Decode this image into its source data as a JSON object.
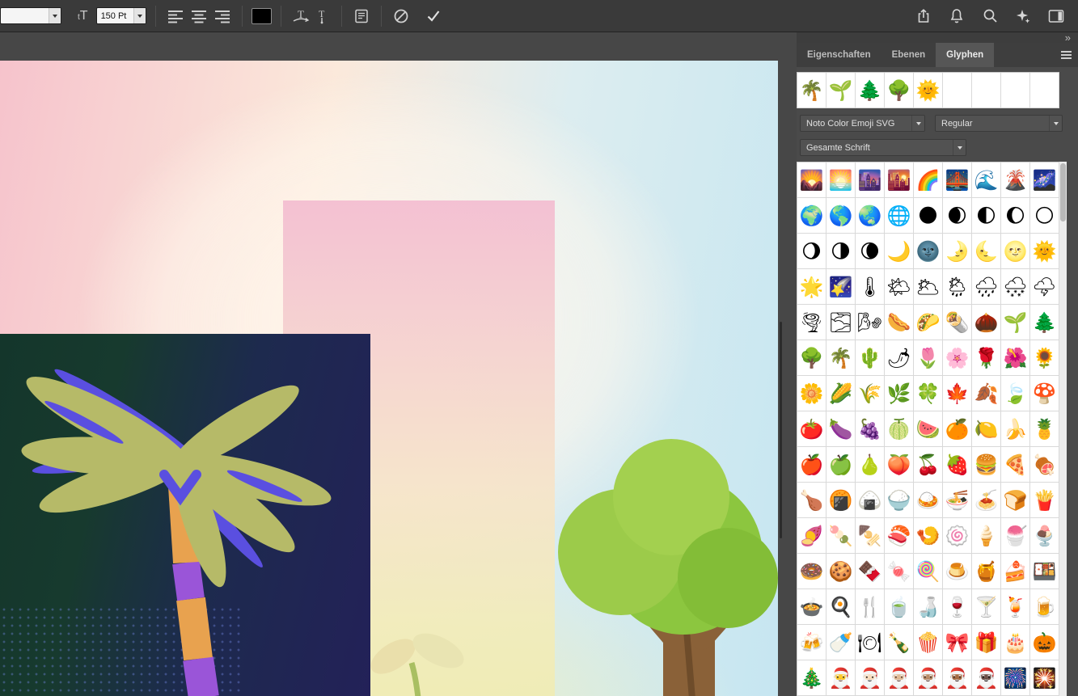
{
  "toolbar": {
    "font_family_value": "",
    "font_size_icon_small": "t",
    "font_size_icon_large": "T",
    "font_size_value": "150 Pt",
    "text_color": "#000000"
  },
  "panel": {
    "collapse_chevron": "»",
    "tabs": [
      "Eigenschaften",
      "Ebenen",
      "Glyphen"
    ],
    "active_tab": "Glyphen",
    "recent_slots": 9,
    "recent_glyphs": [
      "🌴",
      "🌱",
      "🌲",
      "🌳",
      "🌞"
    ],
    "font_family": "Noto Color Emoji SVG",
    "font_style": "Regular",
    "scope": "Gesamte Schrift",
    "columns": 9,
    "glyphs": [
      "🌄",
      "🌅",
      "🌆",
      "🌇",
      "🌈",
      "🌉",
      "🌊",
      "🌋",
      "🌌",
      "🌍",
      "🌎",
      "🌏",
      "🌐",
      "🌑",
      "🌒",
      "🌓",
      "🌔",
      "🌕",
      "🌖",
      "🌗",
      "🌘",
      "🌙",
      "🌚",
      "🌛",
      "🌜",
      "🌝",
      "🌞",
      "🌟",
      "🌠",
      "🌡",
      "🌤",
      "🌥",
      "🌦",
      "🌧",
      "🌨",
      "🌩",
      "🌪",
      "🌫",
      "🌬",
      "🌭",
      "🌮",
      "🌯",
      "🌰",
      "🌱",
      "🌲",
      "🌳",
      "🌴",
      "🌵",
      "🌶",
      "🌷",
      "🌸",
      "🌹",
      "🌺",
      "🌻",
      "🌼",
      "🌽",
      "🌾",
      "🌿",
      "🍀",
      "🍁",
      "🍂",
      "🍃",
      "🍄",
      "🍅",
      "🍆",
      "🍇",
      "🍈",
      "🍉",
      "🍊",
      "🍋",
      "🍌",
      "🍍",
      "🍎",
      "🍏",
      "🍐",
      "🍑",
      "🍒",
      "🍓",
      "🍔",
      "🍕",
      "🍖",
      "🍗",
      "🍘",
      "🍙",
      "🍚",
      "🍛",
      "🍜",
      "🍝",
      "🍞",
      "🍟",
      "🍠",
      "🍡",
      "🍢",
      "🍣",
      "🍤",
      "🍥",
      "🍦",
      "🍧",
      "🍨",
      "🍩",
      "🍪",
      "🍫",
      "🍬",
      "🍭",
      "🍮",
      "🍯",
      "🍰",
      "🍱",
      "🍲",
      "🍳",
      "🍴",
      "🍵",
      "🍶",
      "🍷",
      "🍸",
      "🍹",
      "🍺",
      "🍻",
      "🍼",
      "🍽",
      "🍾",
      "🍿",
      "🎀",
      "🎁",
      "🎂",
      "🎃",
      "🎄",
      "🎅",
      "🎅🏻",
      "🎅🏼",
      "🎅🏽",
      "🎅🏾",
      "🎅🏿",
      "🎆",
      "🎇"
    ]
  },
  "canvas": {
    "palette": {
      "background_gradient": [
        "#f6c3cc",
        "#fbe9db",
        "#dcedf0",
        "#c6e6f1"
      ],
      "highlight_ellipse": "#fff7ed",
      "rectangle_gradient": [
        "#f3bdd1",
        "#f6e4c9",
        "#f0ecb4"
      ],
      "night_block_gradient": [
        "#14362b",
        "#232158"
      ],
      "palm_frond": "#b6ba68",
      "palm_accent": "#5a4fe0",
      "trunk_orange": "#e8a24f",
      "trunk_purple": "#9a55d8",
      "tree_green": "#8cc63f",
      "tree_green_light": "#9ccb4a",
      "tree_trunk": "#8a6138",
      "seedling_leaf": "#eadfab"
    }
  }
}
